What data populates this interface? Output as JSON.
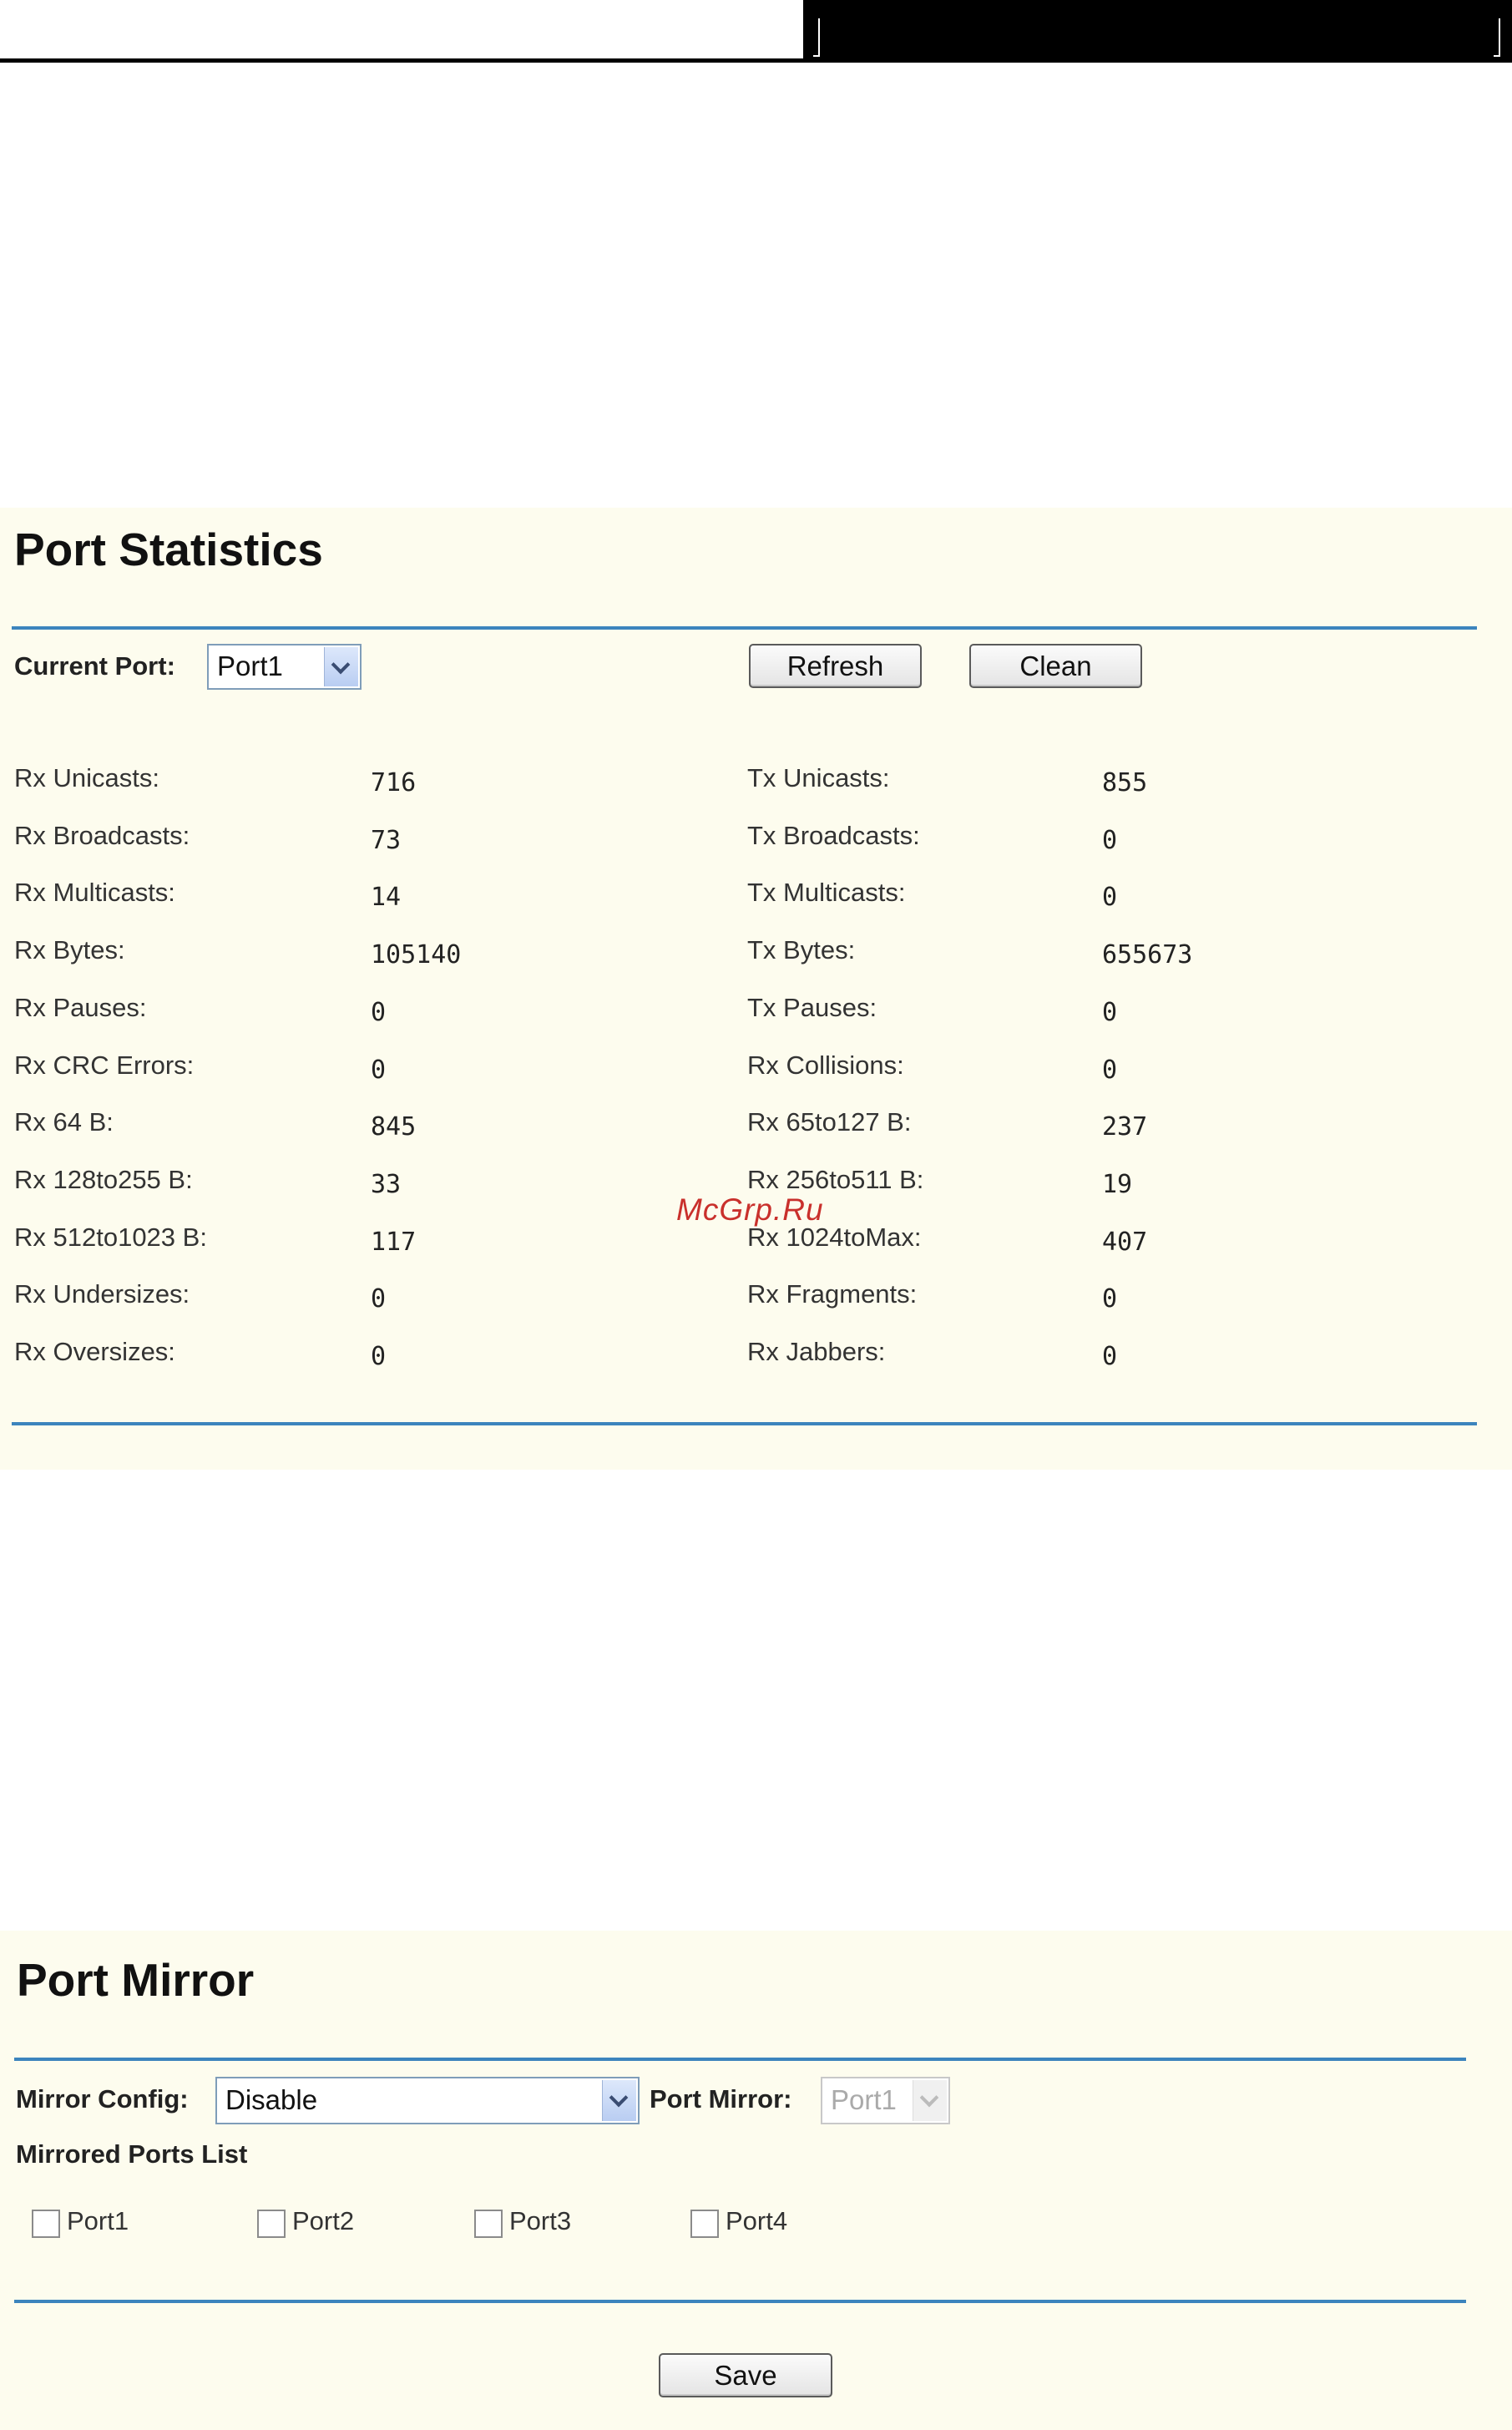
{
  "port_statistics": {
    "title": "Port Statistics",
    "current_port_label": "Current Port:",
    "current_port_value": "Port1",
    "refresh_label": "Refresh",
    "clean_label": "Clean",
    "left_rows": [
      {
        "label": "Rx Unicasts:",
        "value": "716"
      },
      {
        "label": "Rx Broadcasts:",
        "value": "73"
      },
      {
        "label": "Rx Multicasts:",
        "value": "14"
      },
      {
        "label": "Rx Bytes:",
        "value": "105140"
      },
      {
        "label": "Rx Pauses:",
        "value": "0"
      },
      {
        "label": "Rx CRC Errors:",
        "value": "0"
      },
      {
        "label": "Rx 64 B:",
        "value": "845"
      },
      {
        "label": "Rx 128to255 B:",
        "value": "33"
      },
      {
        "label": "Rx 512to1023 B:",
        "value": "117"
      },
      {
        "label": "Rx Undersizes:",
        "value": "0"
      },
      {
        "label": "Rx Oversizes:",
        "value": "0"
      }
    ],
    "right_rows": [
      {
        "label": "Tx Unicasts:",
        "value": "855"
      },
      {
        "label": "Tx Broadcasts:",
        "value": "0"
      },
      {
        "label": "Tx Multicasts:",
        "value": "0"
      },
      {
        "label": "Tx Bytes:",
        "value": "655673"
      },
      {
        "label": "Tx Pauses:",
        "value": "0"
      },
      {
        "label": "Rx Collisions:",
        "value": "0"
      },
      {
        "label": "Rx 65to127 B:",
        "value": "237"
      },
      {
        "label": "Rx 256to511 B:",
        "value": "19"
      },
      {
        "label": "Rx 1024toMax:",
        "value": "407"
      },
      {
        "label": "Rx Fragments:",
        "value": "0"
      },
      {
        "label": "Rx Jabbers:",
        "value": "0"
      }
    ]
  },
  "watermark": "McGrp.Ru",
  "port_mirror": {
    "title": "Port Mirror",
    "mirror_config_label": "Mirror Config:",
    "mirror_config_value": "Disable",
    "port_mirror_label": "Port Mirror:",
    "port_mirror_value": "Port1",
    "mirrored_ports_label": "Mirrored Ports List",
    "ports": [
      "Port1",
      "Port2",
      "Port3",
      "Port4"
    ],
    "save_label": "Save"
  },
  "colors": {
    "panel_bg": "#fdfcee",
    "rule": "#3c84bd",
    "watermark": "#c9302c"
  }
}
